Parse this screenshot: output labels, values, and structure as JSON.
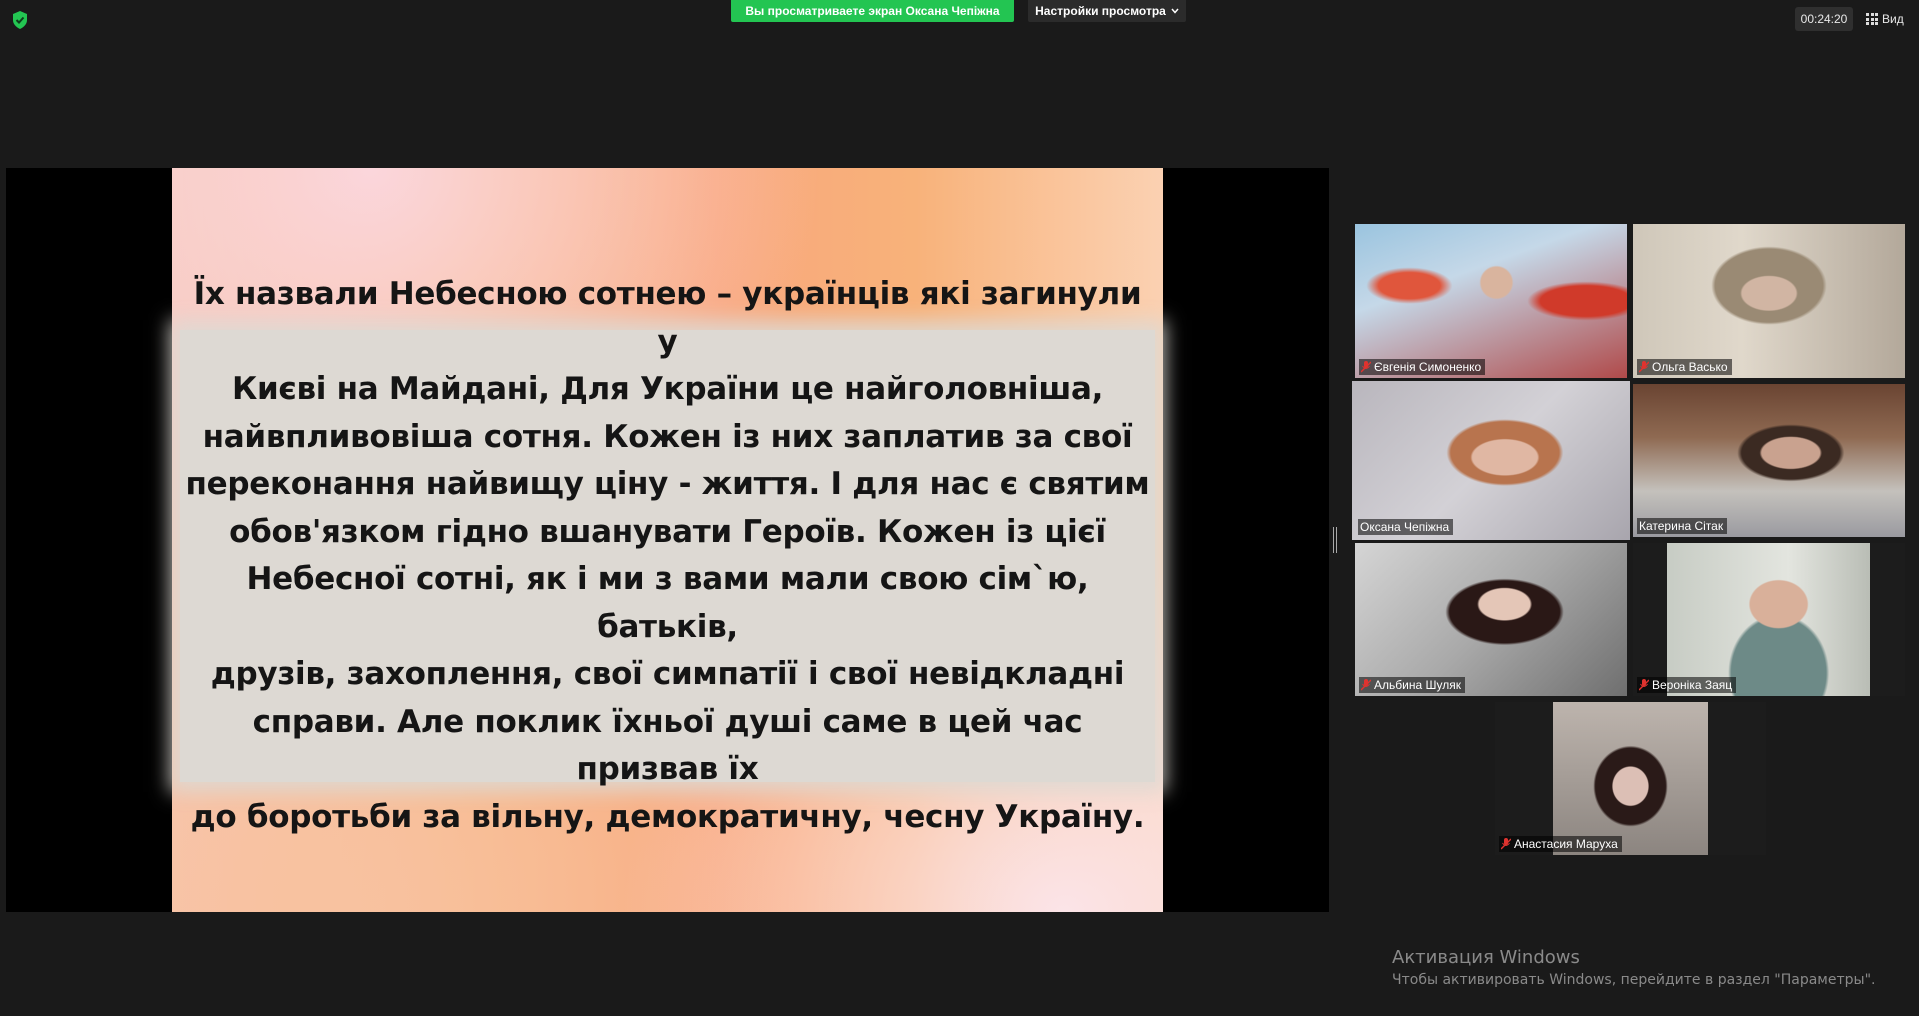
{
  "top_bar": {
    "share_banner": "Вы просматриваете экран Оксана Чепіжна",
    "view_settings": "Настройки просмотра",
    "timer": "00:24:20",
    "view_label": "Вид"
  },
  "slide": {
    "text": "Їх назвали Небесною сотнею – українців які загинули у\nКиєві на Майдані, Для України це найголовніша,\nнайвпливовіша сотня. Кожен із них заплатив за свої\nпереконання найвищу ціну - життя.       І для нас є святим\nобов'язком гідно вшанувати Героїв. Кожен із цієї\nНебесної сотні, як і ми з вами мали свою сім`ю, батьків,\nдрузів, захоплення, свої симпатії і свої невідкладні\nсправи. Але поклик їхньої душі саме в цей час призвав їх\nдо боротьби за вільну, демократичну, чесну Україну."
  },
  "participants": [
    {
      "name": "Євгенія Симоненко",
      "muted": true
    },
    {
      "name": "Ольга Васько",
      "muted": true
    },
    {
      "name": "Оксана Чепіжна",
      "muted": false,
      "active": true
    },
    {
      "name": "Катерина Сітак",
      "muted": false
    },
    {
      "name": "Альбина Шуляк",
      "muted": true
    },
    {
      "name": "Вероніка Заяц",
      "muted": true
    },
    {
      "name": "Анастасия Маруха",
      "muted": true
    }
  ],
  "watermark": {
    "title": "Активация Windows",
    "subtitle": "Чтобы активировать Windows, перейдите в раздел \"Параметры\"."
  },
  "colors": {
    "banner": "#23c552",
    "active_speaker": "#e8e84a",
    "muted_icon": "#e0332f",
    "shield": "#23c552"
  }
}
